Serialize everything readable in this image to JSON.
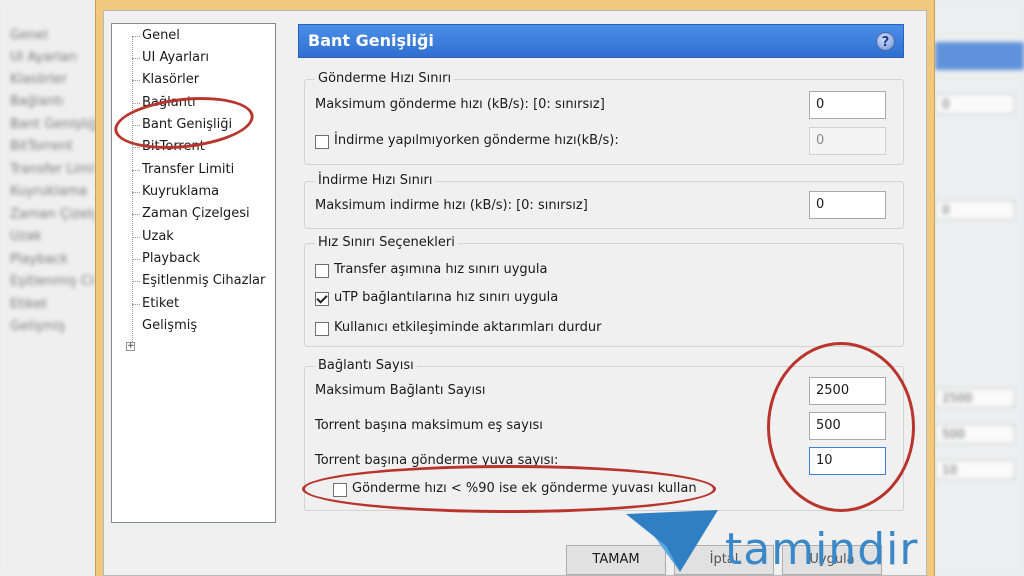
{
  "background_left": [
    "Genel",
    "UI Ayarları",
    "Klasörler",
    "Bağlantı",
    "Bant Genişliği",
    "BitTorrent",
    "Transfer Limiti",
    "Kuyruklama",
    "Zaman Çizelgesi",
    "Uzak",
    "Playback",
    "Eşitlenmiş Cihazlar",
    "Etiket",
    "Gelişmiş"
  ],
  "background_right": [
    "0",
    "0",
    "2500",
    "500",
    "10"
  ],
  "tree": {
    "items": [
      "Genel",
      "UI Ayarları",
      "Klasörler",
      "Bağlantı",
      "Bant Genişliği",
      "BitTorrent",
      "Transfer Limiti",
      "Kuyruklama",
      "Zaman Çizelgesi",
      "Uzak",
      "Playback",
      "Eşitlenmiş Cihazlar",
      "Etiket",
      "Gelişmiş"
    ],
    "selected": "Bant Genişliği",
    "expander": "+"
  },
  "header": {
    "title": "Bant Genişliği",
    "help": "?"
  },
  "upload_group": {
    "title": "Gönderme Hızı Sınırı",
    "max_label": "Maksimum gönderme hızı (kB/s): [0: sınırsız]",
    "max_value": "0",
    "alt_label": "İndirme yapılmıyorken gönderme hızı(kB/s):",
    "alt_checked": false,
    "alt_value": "0"
  },
  "download_group": {
    "title": "İndirme Hızı Sınırı",
    "max_label": "Maksimum indirme hızı (kB/s): [0: sınırsız]",
    "max_value": "0"
  },
  "limit_options_group": {
    "title": "Hız Sınırı Seçenekleri",
    "options": [
      {
        "label": "Transfer aşımına hız sınırı uygula",
        "checked": false
      },
      {
        "label": "uTP bağlantılarına hız sınırı uygula",
        "checked": true
      },
      {
        "label": "Kullanıcı etkileşiminde aktarımları durdur",
        "checked": false
      }
    ]
  },
  "connections_group": {
    "title": "Bağlantı Sayısı",
    "max_conn_label": "Maksimum Bağlantı Sayısı",
    "max_conn_value": "2500",
    "peers_label": "Torrent başına maksimum eş sayısı",
    "peers_value": "500",
    "slots_label": "Torrent başına gönderme yuva sayısı:",
    "slots_value": "10",
    "extra_slots_label": "Gönderme hızı < %90 ise ek gönderme yuvası kullan",
    "extra_slots_checked": false
  },
  "buttons": {
    "ok": "TAMAM",
    "cancel": "İptal",
    "apply": "Uygula"
  },
  "watermark": {
    "brand": "tamindir"
  },
  "colors": {
    "header": "#3a7fe0",
    "annotation": "#b8342c",
    "watermark": "#3a88c8",
    "frame": "#f0c87e"
  }
}
